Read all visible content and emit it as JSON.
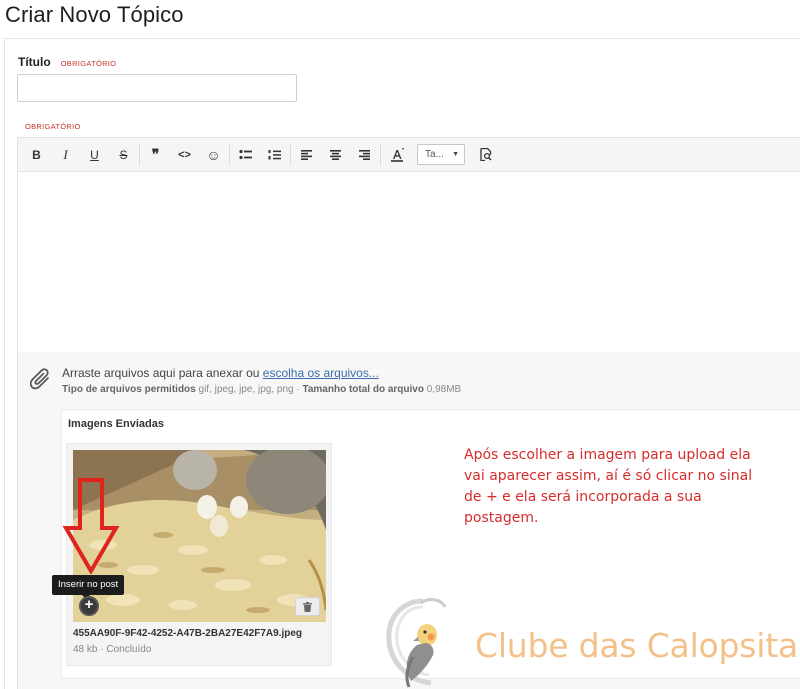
{
  "page": {
    "title": "Criar Novo Tópico"
  },
  "form": {
    "title_label": "Título",
    "required_label": "OBRIGATÓRIO",
    "title_input_value": "",
    "editor_required_label": "OBRIGATÓRIO"
  },
  "toolbar": {
    "bold": "B",
    "italic": "I",
    "underline": "U",
    "strike": "S",
    "quote": "❞",
    "code": "<>",
    "emoji": "☺",
    "font_size_value": "Ta...",
    "icons": [
      "bold-icon",
      "italic-icon",
      "underline-icon",
      "strikethrough-icon",
      "quote-icon",
      "code-icon",
      "emoji-icon",
      "bullet-list-icon",
      "numbered-list-icon",
      "align-left-icon",
      "align-center-icon",
      "align-right-icon",
      "text-color-icon",
      "font-size-select",
      "preview-icon"
    ]
  },
  "attachments": {
    "drop_text": "Arraste arquivos aqui para anexar ou",
    "choose_link": "escolha os arquivos...",
    "allowed_label": "Tipo de arquivos permitidos",
    "allowed_types": "gif, jpeg, jpe, jpg, png ·",
    "total_size_label": "Tamanho total do arquivo",
    "total_size_value": "0,98MB"
  },
  "uploaded": {
    "title": "Imagens Enviadas",
    "file_name": "455AA90F-9F42-4252-A47B-2BA27E42F7A9.jpeg",
    "file_meta": "48 kb · Concluído",
    "tooltip": "Inserir no post",
    "insert_symbol": "+"
  },
  "annotation": {
    "text": "Após escolher a imagem para upload ela vai aparecer assim, aí é só clicar no sinal de + e ela será incorporada a sua postagem.",
    "color": "#d62c2c"
  },
  "watermark": {
    "text": "Clube das Calopsitas",
    "color": "#f4c089"
  }
}
